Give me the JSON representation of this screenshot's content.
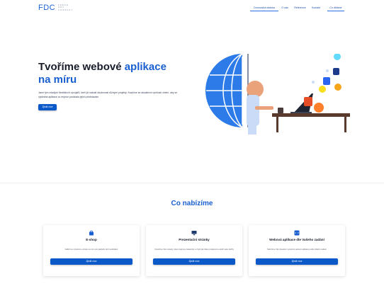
{
  "brand": {
    "logo_text": "FDC",
    "logo_sub": [
      "FRESH",
      "DEV",
      "COMPANY"
    ],
    "primary_color": "#1a5fd0",
    "button_color": "#0b58c9"
  },
  "nav": {
    "items": [
      {
        "label": "Domovská stránka",
        "active": true
      },
      {
        "label": "O nás",
        "active": false
      },
      {
        "label": "Reference",
        "active": false
      },
      {
        "label": "Kontakt",
        "active": false
      },
      {
        "label": "Co děláme",
        "active": true
      }
    ]
  },
  "hero": {
    "title_part1": "Tvoříme webové ",
    "title_accent1": "aplikace",
    "title_accent2": "na míru",
    "description": "Jsme tým mladých flexibilních vývojářů, kteří již nabrali zkušenosti různými projekty. Snažíme se aktuálními rychlostí vlnění, aby se výsledná aplikace co nejvíce podobala jejich představám",
    "cta_label": "Zjistit více"
  },
  "services": {
    "title": "Co nabízíme",
    "cards": [
      {
        "icon": "shopping-bag-icon",
        "title": "E-shop",
        "text": "Nabízíme vytvoření e-shopu na míru pro jakýkoliv druh podnikání",
        "button": "Zjistit více"
      },
      {
        "icon": "monitor-icon",
        "title": "Prezentační stránky",
        "text": "Vytvoříme Vám stránky, které zaujmou zákazníky a zvýší tak Vaše prodejnost a ukáží vaše služby",
        "button": "Zjistit více"
      },
      {
        "icon": "code-window-icon",
        "title": "Webová aplikace dle Vašeho zadání",
        "text": "Nabízíme Vám kreativní vytvoření webové aplikace podle Vašeho zadání",
        "button": "Zjistit více"
      }
    ]
  }
}
